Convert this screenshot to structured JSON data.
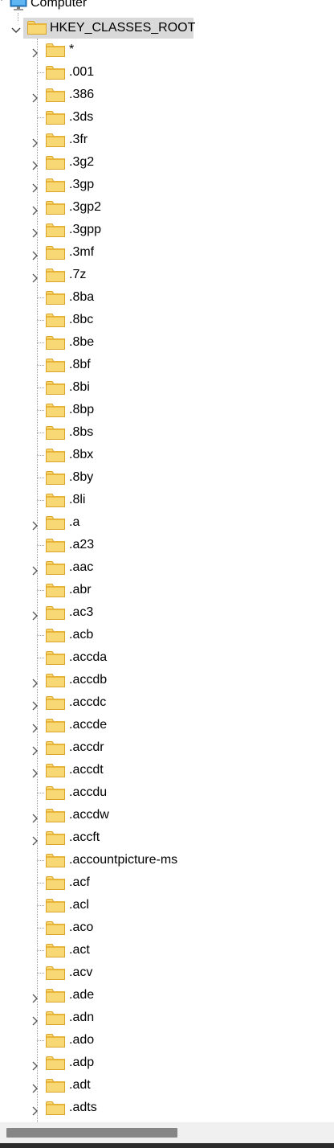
{
  "tree": {
    "computer_label": "Computer",
    "root_label": "HKEY_CLASSES_ROOT",
    "children": [
      {
        "label": "*",
        "expandable": true
      },
      {
        "label": ".001",
        "expandable": false
      },
      {
        "label": ".386",
        "expandable": true
      },
      {
        "label": ".3ds",
        "expandable": false
      },
      {
        "label": ".3fr",
        "expandable": true
      },
      {
        "label": ".3g2",
        "expandable": true
      },
      {
        "label": ".3gp",
        "expandable": true
      },
      {
        "label": ".3gp2",
        "expandable": true
      },
      {
        "label": ".3gpp",
        "expandable": true
      },
      {
        "label": ".3mf",
        "expandable": true
      },
      {
        "label": ".7z",
        "expandable": true
      },
      {
        "label": ".8ba",
        "expandable": false
      },
      {
        "label": ".8bc",
        "expandable": false
      },
      {
        "label": ".8be",
        "expandable": false
      },
      {
        "label": ".8bf",
        "expandable": false
      },
      {
        "label": ".8bi",
        "expandable": false
      },
      {
        "label": ".8bp",
        "expandable": false
      },
      {
        "label": ".8bs",
        "expandable": false
      },
      {
        "label": ".8bx",
        "expandable": false
      },
      {
        "label": ".8by",
        "expandable": false
      },
      {
        "label": ".8li",
        "expandable": false
      },
      {
        "label": ".a",
        "expandable": true
      },
      {
        "label": ".a23",
        "expandable": false
      },
      {
        "label": ".aac",
        "expandable": true
      },
      {
        "label": ".abr",
        "expandable": false
      },
      {
        "label": ".ac3",
        "expandable": true
      },
      {
        "label": ".acb",
        "expandable": false
      },
      {
        "label": ".accda",
        "expandable": false
      },
      {
        "label": ".accdb",
        "expandable": true
      },
      {
        "label": ".accdc",
        "expandable": true
      },
      {
        "label": ".accde",
        "expandable": true
      },
      {
        "label": ".accdr",
        "expandable": true
      },
      {
        "label": ".accdt",
        "expandable": true
      },
      {
        "label": ".accdu",
        "expandable": false
      },
      {
        "label": ".accdw",
        "expandable": true
      },
      {
        "label": ".accft",
        "expandable": true
      },
      {
        "label": ".accountpicture-ms",
        "expandable": false
      },
      {
        "label": ".acf",
        "expandable": false
      },
      {
        "label": ".acl",
        "expandable": false
      },
      {
        "label": ".aco",
        "expandable": false
      },
      {
        "label": ".act",
        "expandable": false
      },
      {
        "label": ".acv",
        "expandable": false
      },
      {
        "label": ".ade",
        "expandable": true
      },
      {
        "label": ".adn",
        "expandable": true
      },
      {
        "label": ".ado",
        "expandable": false
      },
      {
        "label": ".adp",
        "expandable": true
      },
      {
        "label": ".adt",
        "expandable": true
      },
      {
        "label": ".adts",
        "expandable": true
      }
    ]
  },
  "colors": {
    "folder_fill": "#f8d775",
    "folder_tab": "#e8b53a",
    "selection": "#d9d9d9",
    "scrollbar_thumb": "#868686"
  },
  "icons": {
    "computer": "computer-icon",
    "folder": "folder-icon",
    "expand": "chevron-right-icon",
    "collapse": "chevron-down-icon"
  }
}
